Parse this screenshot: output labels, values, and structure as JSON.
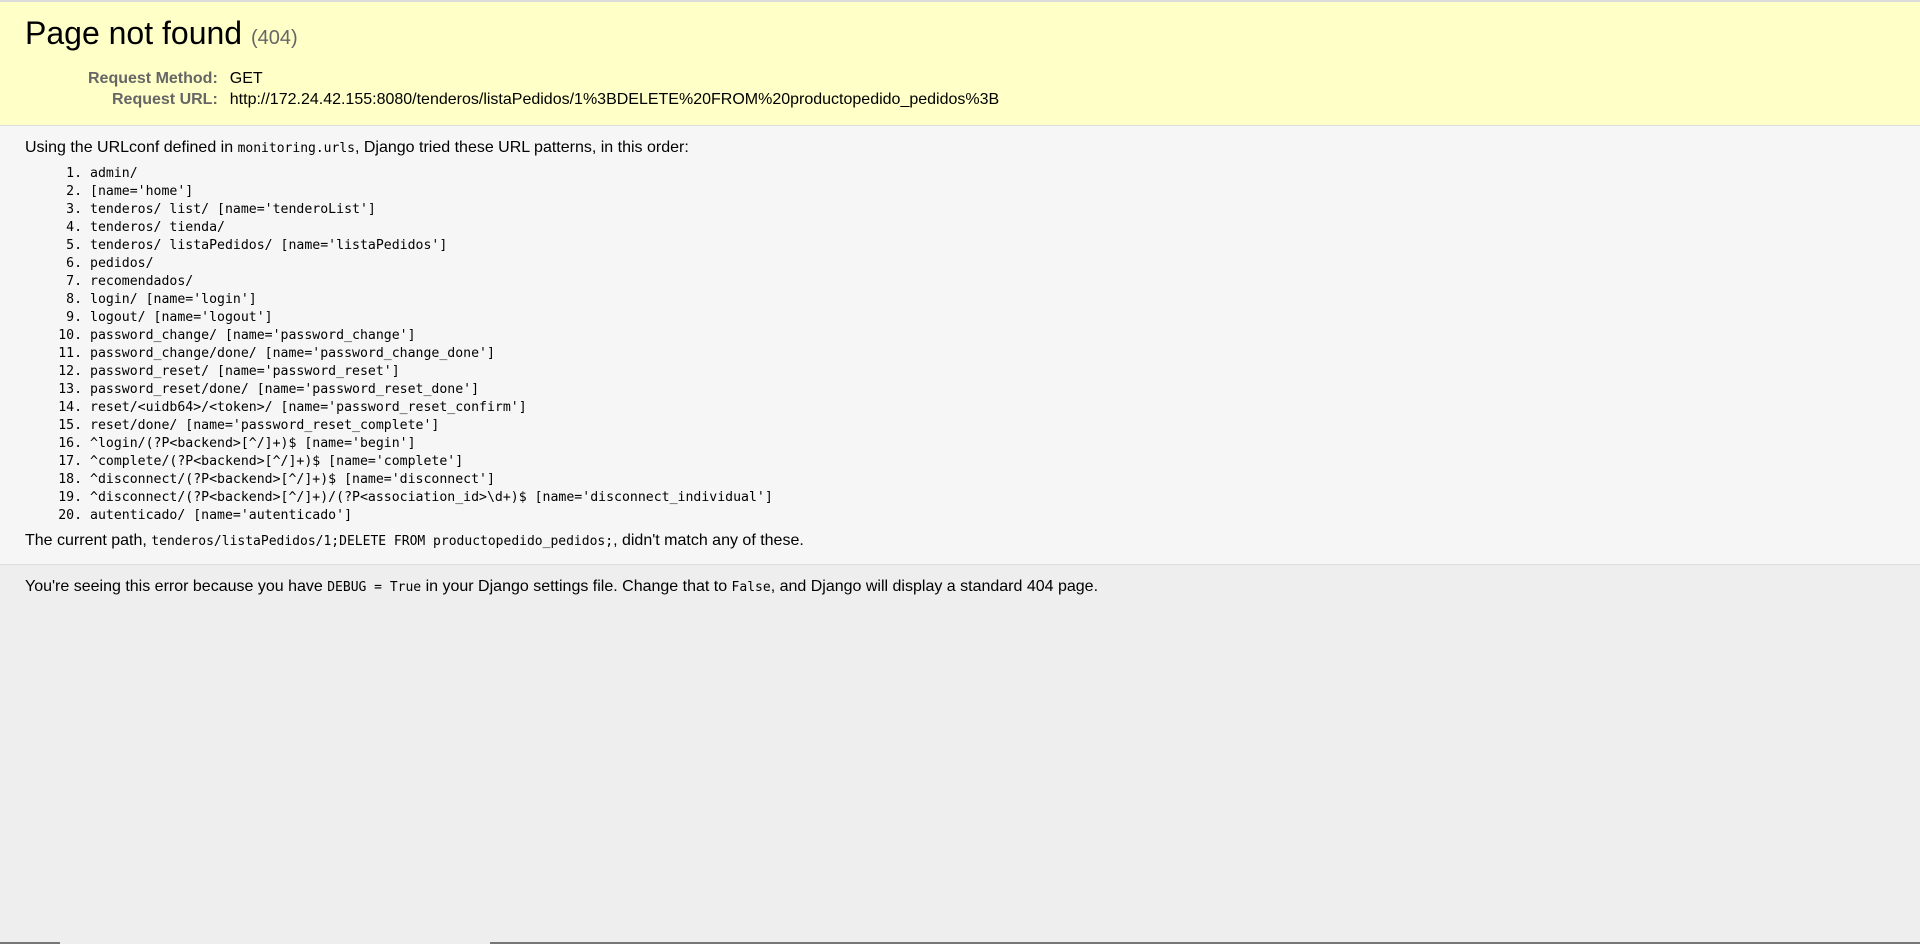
{
  "summary": {
    "title": "Page not found",
    "status_code": "(404)",
    "request_method_label": "Request Method:",
    "request_method": "GET",
    "request_url_label": "Request URL:",
    "request_url": "http://172.24.42.155:8080/tenderos/listaPedidos/1%3BDELETE%20FROM%20productopedido_pedidos%3B"
  },
  "info": {
    "intro_prefix": "Using the URLconf defined in ",
    "urlconf": "monitoring.urls",
    "intro_suffix": ", Django tried these URL patterns, in this order:",
    "patterns": [
      "admin/",
      "[name='home']",
      "tenderos/ list/ [name='tenderoList']",
      "tenderos/ tienda/",
      "tenderos/ listaPedidos/ [name='listaPedidos']",
      "pedidos/",
      "recomendados/",
      "login/ [name='login']",
      "logout/ [name='logout']",
      "password_change/ [name='password_change']",
      "password_change/done/ [name='password_change_done']",
      "password_reset/ [name='password_reset']",
      "password_reset/done/ [name='password_reset_done']",
      "reset/<uidb64>/<token>/ [name='password_reset_confirm']",
      "reset/done/ [name='password_reset_complete']",
      "^login/(?P<backend>[^/]+)$ [name='begin']",
      "^complete/(?P<backend>[^/]+)$ [name='complete']",
      "^disconnect/(?P<backend>[^/]+)$ [name='disconnect']",
      "^disconnect/(?P<backend>[^/]+)/(?P<association_id>\\d+)$ [name='disconnect_individual']",
      "autenticado/ [name='autenticado']"
    ],
    "current_path_prefix": "The current path, ",
    "current_path": "tenderos/listaPedidos/1;DELETE FROM productopedido_pedidos;",
    "current_path_suffix": ", didn't match any of these."
  },
  "explanation": {
    "prefix": "You're seeing this error because you have ",
    "debug_setting": "DEBUG = True",
    "middle": " in your Django settings file. Change that to ",
    "false_value": "False",
    "suffix": ", and Django will display a standard 404 page."
  }
}
